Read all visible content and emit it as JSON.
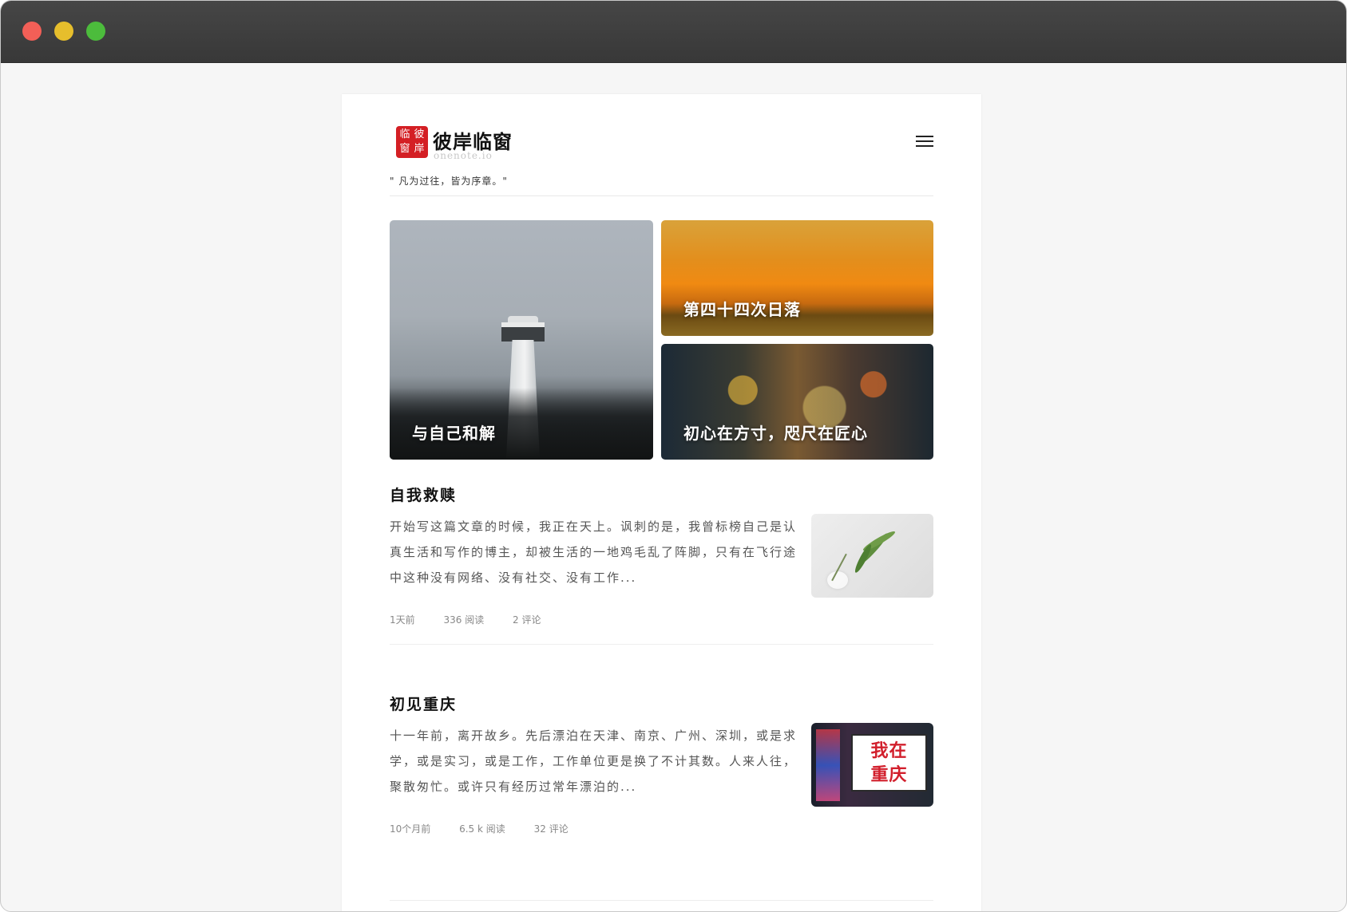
{
  "window": {
    "controls": [
      "close",
      "minimize",
      "zoom"
    ]
  },
  "brand": {
    "seal_chars": [
      "临",
      "彼",
      "窗",
      "岸"
    ],
    "name": "彼岸临窗",
    "domain": "onenote.io",
    "motto": "\" 凡为过往，皆为序章。\""
  },
  "featured": [
    {
      "title": "与自己和解",
      "image": "lighthouse"
    },
    {
      "title": "第四十四次日落",
      "image": "sunset"
    },
    {
      "title": "初心在方寸，咫尺在匠心",
      "image": "street"
    }
  ],
  "posts": [
    {
      "title": "自我救赎",
      "excerpt": "开始写这篇文章的时候，我正在天上。讽刺的是，我曾标榜自己是认真生活和写作的博主，却被生活的一地鸡毛乱了阵脚，只有在飞行途中这种没有网络、没有社交、没有工作...",
      "time": "1天前",
      "reads": "336 阅读",
      "comments": "2 评论",
      "thumb": "plant"
    },
    {
      "title": "初见重庆",
      "excerpt": "十一年前，离开故乡。先后漂泊在天津、南京、广州、深圳，或是求学，或是实习，或是工作，工作单位更是换了不计其数。人来人往，聚散匆忙。或许只有经历过常年漂泊的...",
      "time": "10个月前",
      "reads": "6.5 k 阅读",
      "comments": "32 评论",
      "thumb": "sign",
      "thumb_text": "我在\n重庆"
    }
  ],
  "colors": {
    "titlebar": "#3f3f3f",
    "close": "#f25f57",
    "minimize": "#e6be2c",
    "zoom": "#4cbc3c",
    "seal": "#d41f24"
  },
  "icons": {
    "menu": "hamburger-menu-icon"
  }
}
